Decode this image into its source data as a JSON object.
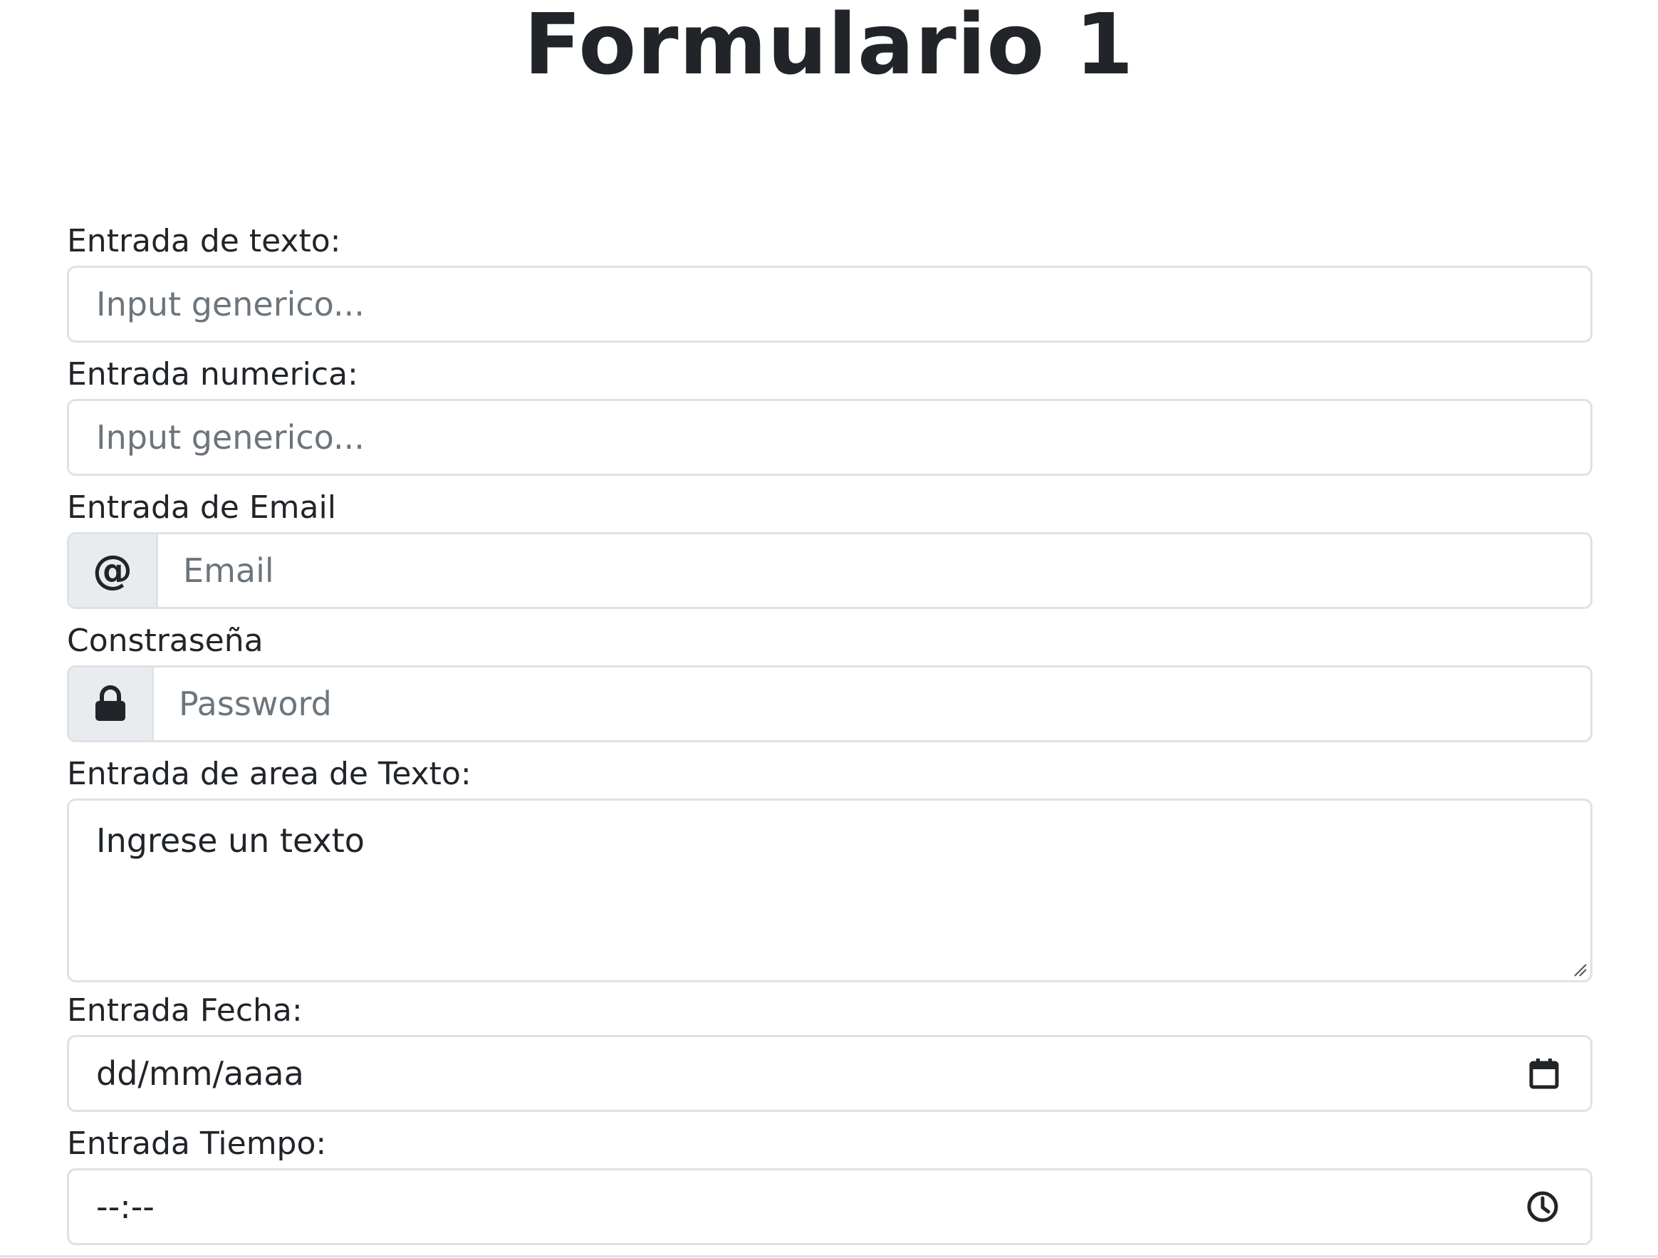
{
  "page": {
    "title": "Formulario 1"
  },
  "fields": {
    "text_input": {
      "label": "Entrada de texto:",
      "placeholder": "Input generico..."
    },
    "number_input": {
      "label": "Entrada numerica:",
      "placeholder": "Input generico..."
    },
    "email_input": {
      "label": "Entrada de Email",
      "addon_symbol": "@",
      "placeholder": "Email"
    },
    "password_input": {
      "label": "Constraseña",
      "addon_icon": "lock-icon",
      "placeholder": "Password"
    },
    "textarea": {
      "label": "Entrada de area de Texto:",
      "value": "Ingrese un texto"
    },
    "date_input": {
      "label": "Entrada Fecha:",
      "value": "dd/mm/aaaa",
      "icon": "calendar-icon"
    },
    "time_input": {
      "label": "Entrada Tiempo:",
      "value": "--:--",
      "icon": "clock-icon"
    }
  },
  "colors": {
    "text": "#212529",
    "placeholder": "#6c757d",
    "border": "#dee2e6",
    "addon_background": "#e9ecef"
  }
}
